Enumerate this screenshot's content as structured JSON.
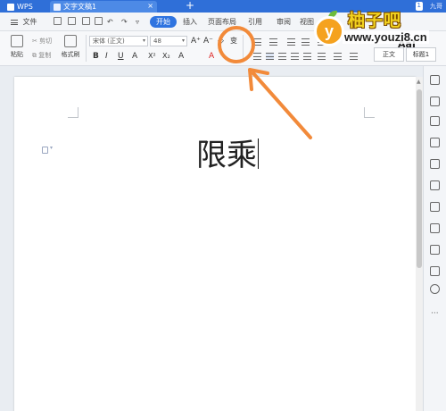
{
  "tabs": {
    "app_label": "WPS",
    "doc_label": "文字文稿1",
    "add_label": "+"
  },
  "title_bar": {
    "badge": "1",
    "user": "九哥"
  },
  "menu": {
    "file_label": "文件",
    "items": [
      "开始",
      "插入",
      "页面布局",
      "引用",
      "审阅",
      "视图"
    ],
    "active_index": 0
  },
  "toolbar": {
    "paste_label": "粘贴",
    "cut_label": "剪切",
    "copy_label": "复制",
    "format_painter_label": "格式刷",
    "font_name": "宋体 (正文)",
    "font_size": "48",
    "grow_font": "A⁺",
    "shrink_font": "A⁻",
    "clear_format": "◇",
    "phonetic_label": "变",
    "format_buttons": [
      "B",
      "I",
      "U",
      "A",
      "X²",
      "X₂",
      "A",
      "A"
    ],
    "style_main": "正文",
    "style_heading": "标题1",
    "style_preview": "AaI"
  },
  "document": {
    "text": "限乘"
  },
  "annotation": {
    "accent_color": "#f28a3a"
  },
  "watermark": {
    "logo_letter": "y",
    "site_name": "柚子吧",
    "url": "www.youzi8.cn"
  },
  "colors": {
    "tab_bar": "#2f6fd8",
    "start_tab": "#2f74e0"
  }
}
